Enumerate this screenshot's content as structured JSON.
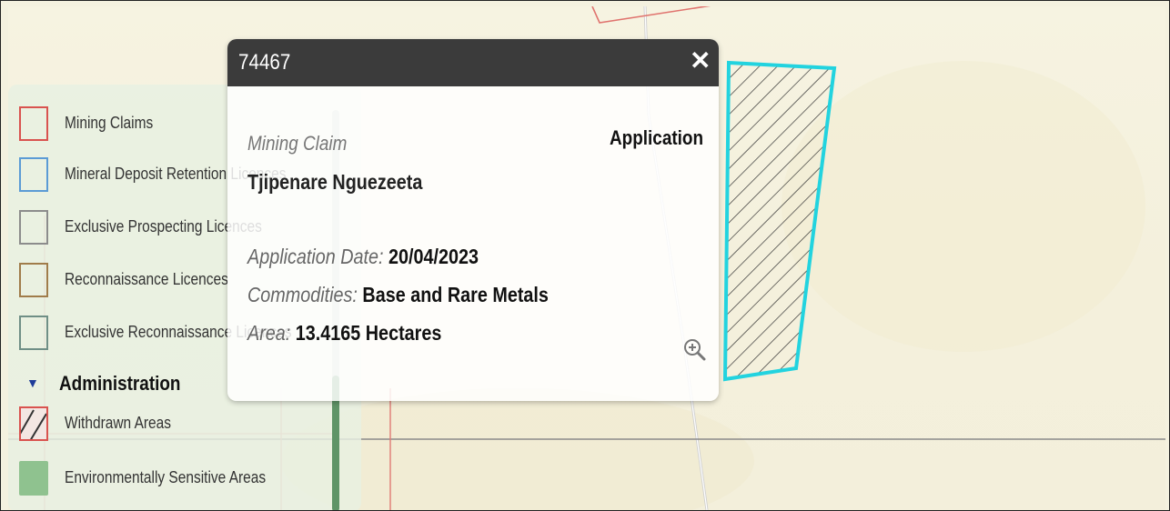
{
  "popup": {
    "title": "74467",
    "close_glyph": "✕",
    "status": "Application",
    "title_type": "Mining Claim",
    "holder": "Tjipenare Nguezeeta",
    "fields": [
      {
        "label": "Application Date:",
        "value": "20/04/2023"
      },
      {
        "label": "Commodities:",
        "value": "Base and Rare Metals"
      },
      {
        "label": "Area:",
        "value": "13.4165 Hectares"
      }
    ],
    "zoom_icon": "zoom-in-icon"
  },
  "legend": {
    "items": [
      {
        "label": "Mining Claims",
        "swatch": "outline",
        "color": "#d9534f"
      },
      {
        "label": "Mineral Deposit Retention Licences",
        "swatch": "outline",
        "color": "#5b9bd5"
      },
      {
        "label": "Exclusive Prospecting Licences",
        "swatch": "outline",
        "color": "#8c8c8c"
      },
      {
        "label": "Reconnaissance Licences",
        "swatch": "outline",
        "color": "#a07c4a"
      },
      {
        "label": "Exclusive Reconnaissance Licences",
        "swatch": "outline",
        "color": "#6f8f86"
      }
    ],
    "section": {
      "label": "Administration",
      "expanded": true
    },
    "admin_items": [
      {
        "label": "Withdrawn Areas",
        "swatch": "hatched",
        "color": "#d9534f"
      },
      {
        "label": "Environmentally Sensitive Areas",
        "swatch": "filled",
        "color": "#8fc28f"
      }
    ]
  },
  "map": {
    "selected_outline_color": "#22d3df",
    "hatch_color": "#333333",
    "claim_outline_color": "#e0736e"
  }
}
